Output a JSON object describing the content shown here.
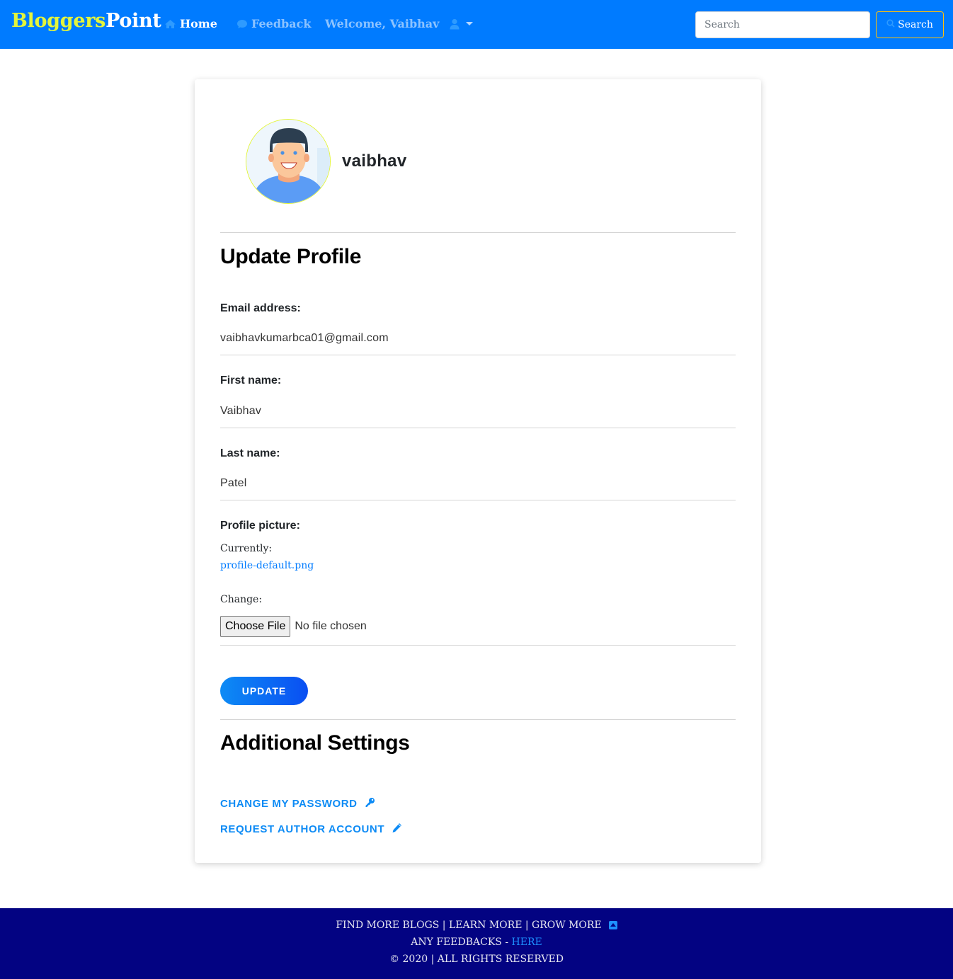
{
  "navbar": {
    "brand_part1": "Bloggers",
    "brand_part2": "Point",
    "home": "Home",
    "feedback": "Feedback",
    "welcome": "Welcome, Vaibhav",
    "search_placeholder": "Search",
    "search_button": "Search"
  },
  "profile": {
    "username": "vaibhav"
  },
  "update_section": {
    "title": "Update Profile",
    "email_label": "Email address:",
    "email_value": "vaibhavkumarbca01@gmail.com",
    "first_name_label": "First name:",
    "first_name_value": "Vaibhav",
    "last_name_label": "Last name:",
    "last_name_value": "Patel",
    "picture_label": "Profile picture:",
    "currently_label": "Currently:",
    "current_file": "profile-default.png",
    "change_label": "Change:",
    "choose_file_button": "Choose File",
    "no_file_text": "No file chosen",
    "update_button": "UPDATE"
  },
  "additional": {
    "title": "Additional Settings",
    "change_password": "CHANGE MY PASSWORD",
    "request_author": "REQUEST AUTHOR ACCOUNT"
  },
  "footer": {
    "line1": "FIND MORE BLOGS | LEARN MORE | GROW MORE",
    "line2_prefix": "ANY FEEDBACKS - ",
    "line2_link": "HERE",
    "line3": "© 2020 | ALL RIGHTS RESERVED"
  },
  "colors": {
    "navbar": "#007bff",
    "brand_accent": "#e4f53b",
    "footer": "#030382",
    "link": "#0d8bf5"
  }
}
